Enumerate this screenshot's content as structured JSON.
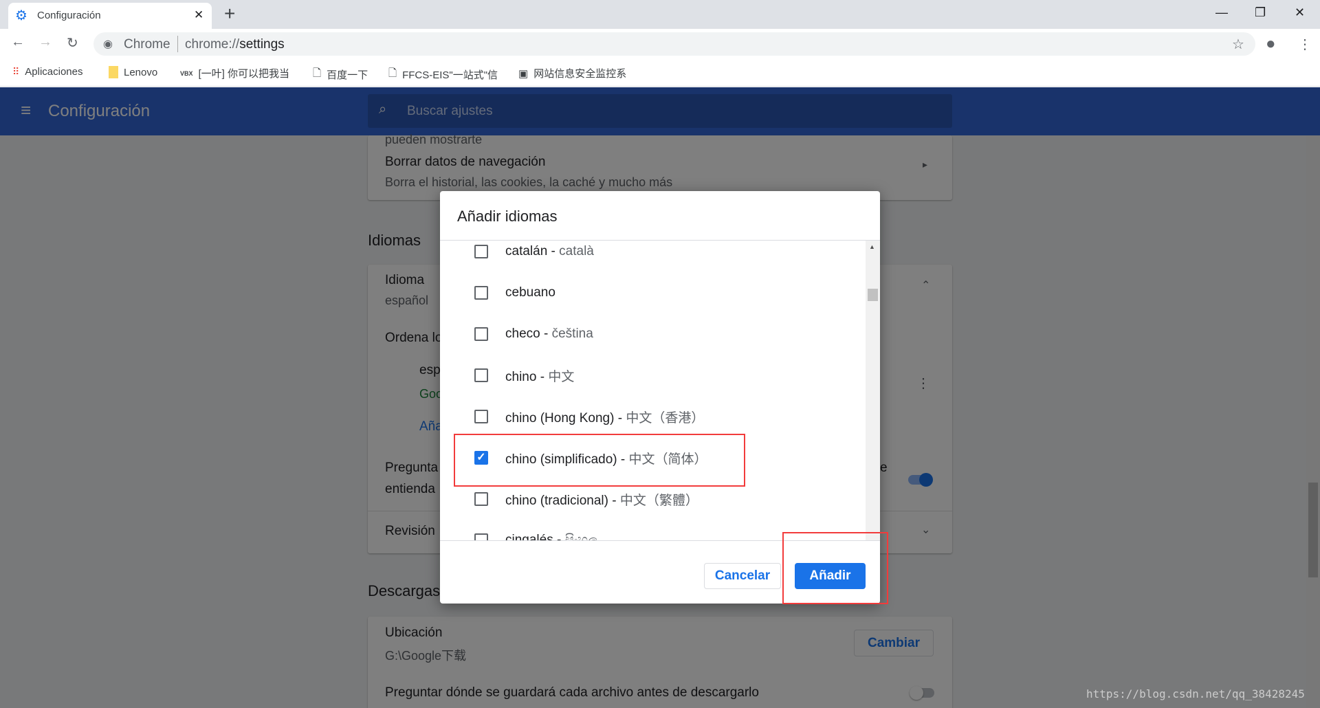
{
  "browser": {
    "tab_title": "Configuración",
    "new_tab": "+",
    "url_origin": "Chrome",
    "url_scheme": "chrome://",
    "url_path": "settings",
    "bookmarks": [
      {
        "label": "Aplicaciones",
        "icon": "apps-grid-icon"
      },
      {
        "label": "Lenovo",
        "icon": "folder-icon"
      },
      {
        "label": "[一叶] 你可以把我当"
      },
      {
        "label": "百度一下",
        "icon": "page-icon"
      },
      {
        "label": "FFCS-EIS\"一站式\"信",
        "icon": "page-icon"
      },
      {
        "label": "网站信息安全监控系"
      }
    ]
  },
  "header": {
    "title": "Configuración",
    "search_placeholder": "Buscar ajustes"
  },
  "page": {
    "clipped_top": "pueden mostrarte",
    "clear_title": "Borrar datos de navegación",
    "clear_sub": "Borra el historial, las cookies, la caché y mucho más",
    "languages_heading": "Idiomas",
    "language_label": "Idioma",
    "language_value": "español",
    "order_label": "Ordena lo",
    "lang_item": "esp",
    "lang_item_sub": "Goo",
    "add_link": "Aña",
    "ask_label": "Pregunta",
    "ask_sub": "entienda",
    "ask_tail": "e",
    "spell_label": "Revisión",
    "downloads_heading": "Descargas",
    "location_label": "Ubicación",
    "location_value": "G:\\Google下载",
    "change_button": "Cambiar",
    "ask_where": "Preguntar dónde se guardará cada archivo antes de descargarlo"
  },
  "dialog": {
    "title": "Añadir idiomas",
    "cancel": "Cancelar",
    "add": "Añadir",
    "languages": [
      {
        "name": "catalán",
        "native": "català",
        "checked": false
      },
      {
        "name": "cebuano",
        "native": "",
        "checked": false
      },
      {
        "name": "checo",
        "native": "čeština",
        "checked": false
      },
      {
        "name": "chino",
        "native": "中文",
        "checked": false
      },
      {
        "name": "chino (Hong Kong)",
        "native": "中文（香港）",
        "checked": false
      },
      {
        "name": "chino (simplificado)",
        "native": "中文（简体）",
        "checked": true
      },
      {
        "name": "chino (tradicional)",
        "native": "中文（繁體）",
        "checked": false
      },
      {
        "name": "cingalés",
        "native": "සිංහල",
        "checked": false
      }
    ]
  },
  "watermark": "https://blog.csdn.net/qq_38428245",
  "colors": {
    "accent": "#1a73e8",
    "header": "#3367d6",
    "highlight": "#f23b3b"
  }
}
